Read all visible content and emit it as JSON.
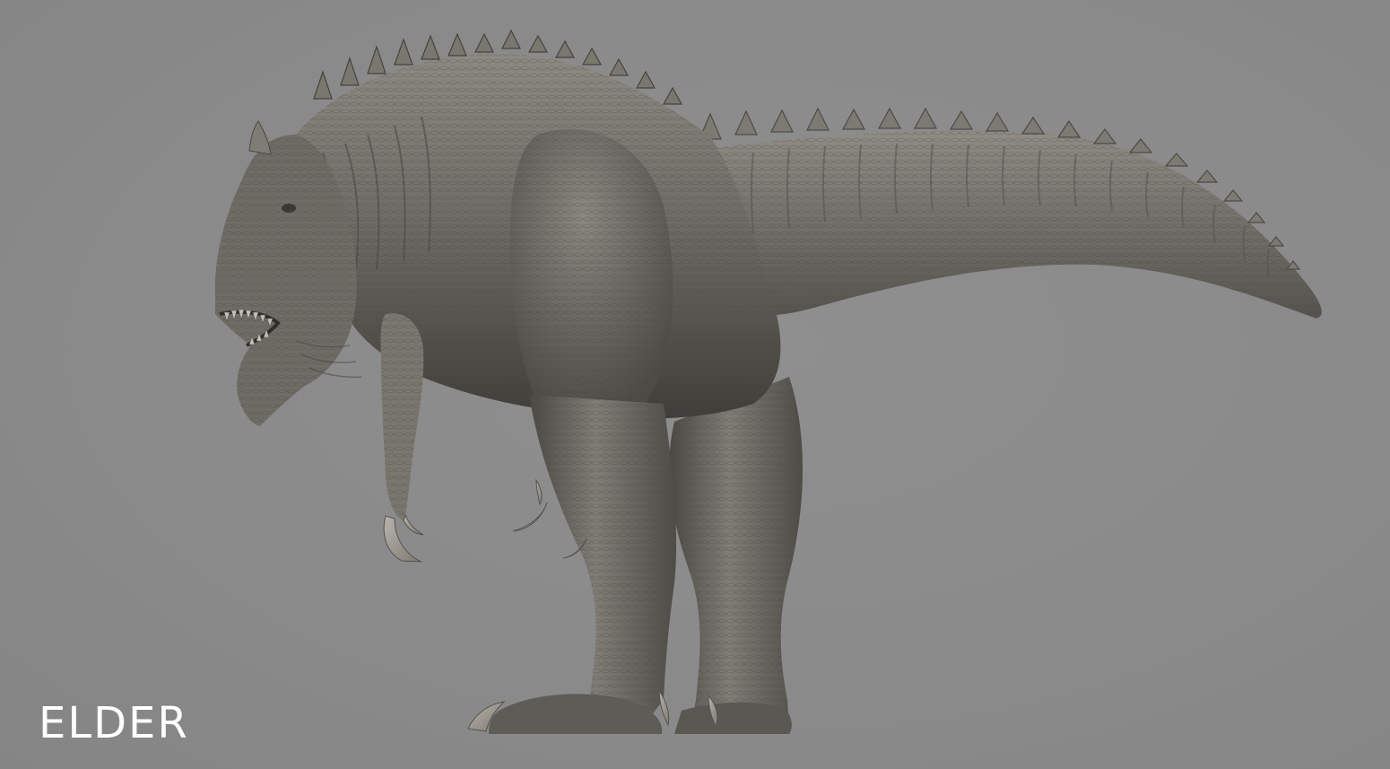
{
  "caption": {
    "label": "ELDER"
  },
  "render": {
    "background_color": "#8b8b8b",
    "model_color": "#6e6c66",
    "model_highlight": "#a19e96",
    "model_shadow": "#3e3c38"
  }
}
